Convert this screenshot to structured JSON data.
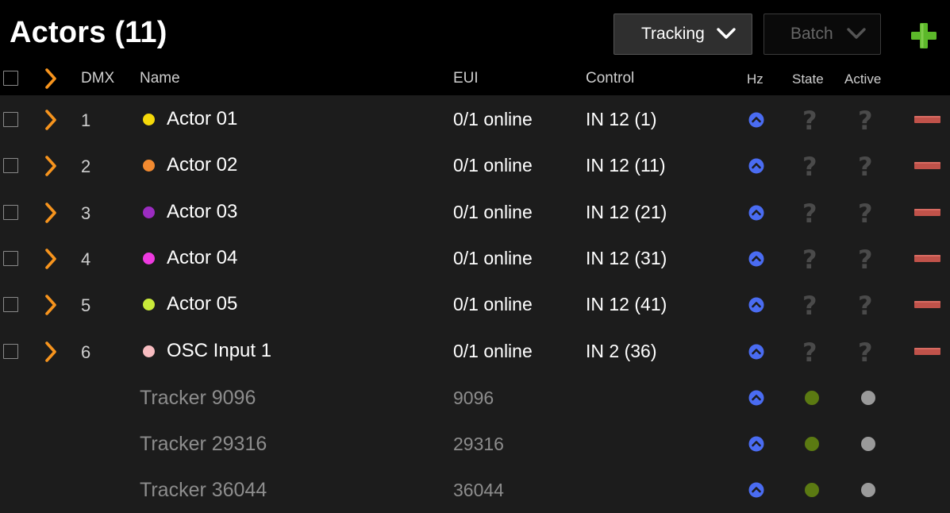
{
  "header": {
    "title": "Actors (11)",
    "tracking_label": "Tracking",
    "batch_label": "Batch"
  },
  "columns": {
    "dmx": "DMX",
    "name": "Name",
    "eui": "EUI",
    "control": "Control",
    "hz": "Hz",
    "state": "State",
    "active": "Active"
  },
  "actors": [
    {
      "dmx": "1",
      "name": "Actor 01",
      "eui": "0/1 online",
      "control": "IN 12 (1)",
      "color": "#f5d90a",
      "state": "?",
      "active": "?"
    },
    {
      "dmx": "2",
      "name": "Actor 02",
      "eui": "0/1 online",
      "control": "IN 12 (11)",
      "color": "#f28a30",
      "state": "?",
      "active": "?"
    },
    {
      "dmx": "3",
      "name": "Actor 03",
      "eui": "0/1 online",
      "control": "IN 12 (21)",
      "color": "#9b2cc0",
      "state": "?",
      "active": "?"
    },
    {
      "dmx": "4",
      "name": "Actor 04",
      "eui": "0/1 online",
      "control": "IN 12 (31)",
      "color": "#ee3ae0",
      "state": "?",
      "active": "?"
    },
    {
      "dmx": "5",
      "name": "Actor 05",
      "eui": "0/1 online",
      "control": "IN 12 (41)",
      "color": "#c9ea3a",
      "state": "?",
      "active": "?"
    },
    {
      "dmx": "6",
      "name": "OSC Input 1",
      "eui": "0/1 online",
      "control": "IN 2 (36)",
      "color": "#f7bcc0",
      "state": "?",
      "active": "?"
    }
  ],
  "trackers": [
    {
      "name": "Tracker 9096",
      "eui": "9096",
      "state_color": "#5b7a12",
      "active_color": "#9a9a9a"
    },
    {
      "name": "Tracker 29316",
      "eui": "29316",
      "state_color": "#5b7a12",
      "active_color": "#9a9a9a"
    },
    {
      "name": "Tracker 36044",
      "eui": "36044",
      "state_color": "#5b7a12",
      "active_color": "#9a9a9a"
    }
  ],
  "colors": {
    "accent_orange": "#f7941d",
    "hz_blue": "#4a6cf2",
    "add_green": "#5cb82a",
    "remove_red": "#c0524a"
  },
  "icons": {
    "expand": "chevron-right-icon",
    "dropdown": "chevron-down-icon",
    "add": "plus-icon",
    "remove": "minus-icon",
    "hz": "chevron-up-circle-icon",
    "unknown": "question-mark-icon"
  }
}
